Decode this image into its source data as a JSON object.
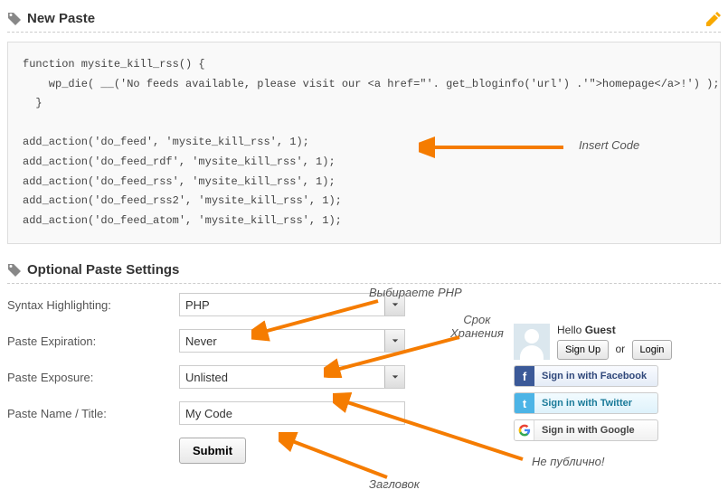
{
  "header_new": "New Paste",
  "header_settings": "Optional Paste Settings",
  "code": "function mysite_kill_rss() {\n    wp_die( __('No feeds available, please visit our <a href=\"'. get_bloginfo('url') .'\">homepage</a>!') );\n  }\n\nadd_action('do_feed', 'mysite_kill_rss', 1);\nadd_action('do_feed_rdf', 'mysite_kill_rss', 1);\nadd_action('do_feed_rss', 'mysite_kill_rss', 1);\nadd_action('do_feed_rss2', 'mysite_kill_rss', 1);\nadd_action('do_feed_atom', 'mysite_kill_rss', 1);",
  "labels": {
    "syntax": "Syntax Highlighting:",
    "expire": "Paste Expiration:",
    "exposure": "Paste Exposure:",
    "name": "Paste Name / Title:"
  },
  "values": {
    "syntax": "PHP",
    "expire": "Never",
    "exposure": "Unlisted",
    "name": "My Code"
  },
  "submit": "Submit",
  "side": {
    "hello": "Hello ",
    "guest": "Guest",
    "signup": "Sign Up",
    "or": "or",
    "login": "Login",
    "fb": "Sign in with Facebook",
    "tw": "Sign in with Twitter",
    "gg": "Sign in with Google"
  },
  "annotations": {
    "insert": "Insert Code",
    "choose_php": "Выбираете PHP",
    "storage": "Срок\nХранения",
    "title": "Загловок",
    "nonpublic": "Не публично!"
  }
}
